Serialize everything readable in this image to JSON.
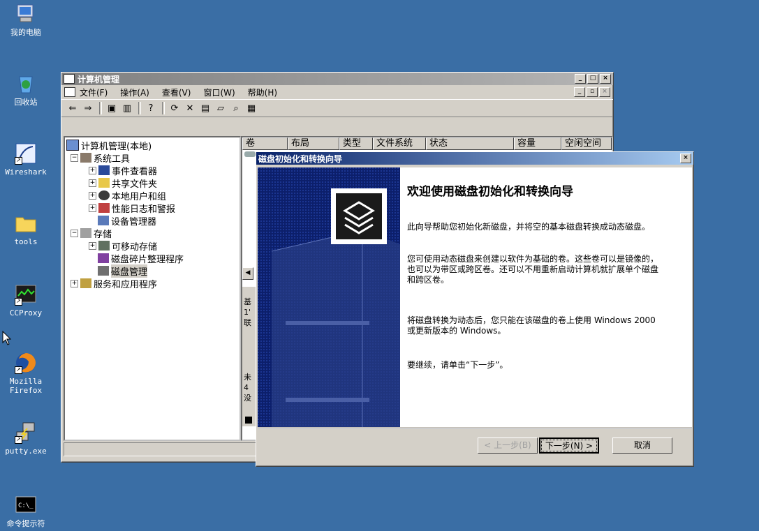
{
  "desktop": {
    "icons": [
      {
        "label": "我的电脑"
      },
      {
        "label": "回收站"
      },
      {
        "label": "Wireshark"
      },
      {
        "label": "tools"
      },
      {
        "label": "CCProxy"
      },
      {
        "label": "Mozilla Firefox"
      },
      {
        "label": "putty.exe"
      },
      {
        "label": "命令提示符"
      }
    ]
  },
  "main_window": {
    "title": "计算机管理",
    "menu": [
      "文件(F)",
      "操作(A)",
      "查看(V)",
      "窗口(W)",
      "帮助(H)"
    ],
    "tree": {
      "root": "计算机管理(本地)",
      "system_tools": "系统工具",
      "event_viewer": "事件查看器",
      "shared_folders": "共享文件夹",
      "local_users": "本地用户和组",
      "perf_logs": "性能日志和警报",
      "device_manager": "设备管理器",
      "storage": "存储",
      "removable": "可移动存储",
      "defrag": "磁盘碎片整理程序",
      "disk_mgmt": "磁盘管理",
      "services": "服务和应用程序"
    },
    "columns": [
      "卷",
      "布局",
      "类型",
      "文件系统",
      "状态",
      "容量",
      "空闲空间"
    ],
    "partial_text": [
      "基",
      "1'",
      "联",
      "未",
      "4",
      "没"
    ]
  },
  "wizard": {
    "title": "磁盘初始化和转换向导",
    "heading": "欢迎使用磁盘初始化和转换向导",
    "para1": "此向导帮助您初始化新磁盘，并将空的基本磁盘转换成动态磁盘。",
    "para2": "您可使用动态磁盘来创建以软件为基础的卷。这些卷可以是镜像的，也可以为带区或跨区卷。还可以不用重新启动计算机就扩展单个磁盘和跨区卷。",
    "para3": "将磁盘转换为动态后，您只能在该磁盘的卷上使用 Windows 2000 或更新版本的 Windows。",
    "para4": "要继续，请单击“下一步”。",
    "back_label": "< 上一步(B)",
    "next_label": "下一步(N) >",
    "cancel_label": "取消"
  }
}
